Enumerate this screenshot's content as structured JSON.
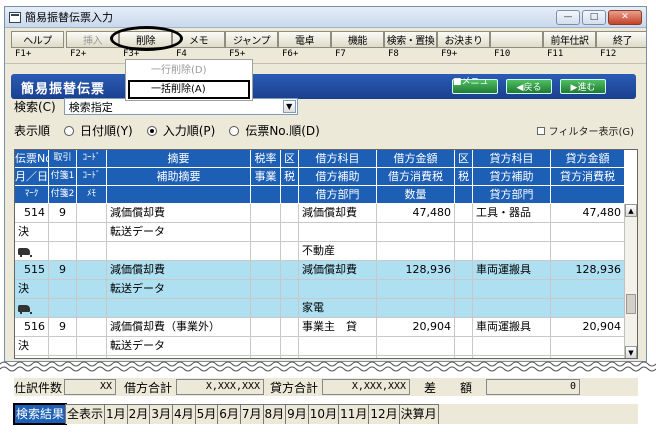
{
  "window": {
    "title": "簡易振替伝票入力",
    "min_glyph": "—",
    "max_glyph": "□",
    "close_glyph": "✕"
  },
  "toolbar": [
    {
      "label": "ヘルプ",
      "code": "F1+",
      "enabled": true
    },
    {
      "label": "挿入",
      "code": "F2+",
      "enabled": false
    },
    {
      "label": "削除",
      "code": "F3+",
      "enabled": true
    },
    {
      "label": "メモ",
      "code": "F4",
      "enabled": true
    },
    {
      "label": "ジャンプ",
      "code": "F5+",
      "enabled": true
    },
    {
      "label": "電卓",
      "code": "F6+",
      "enabled": true
    },
    {
      "label": "機能",
      "code": "F7",
      "enabled": true
    },
    {
      "label": "検索・置換",
      "code": "F8",
      "enabled": true
    },
    {
      "label": "お決まり",
      "code": "F9+",
      "enabled": true
    },
    {
      "label": "",
      "code": "F10",
      "enabled": true
    },
    {
      "label": "前年仕訳",
      "code": "F11",
      "enabled": true
    },
    {
      "label": "終了",
      "code": "F12",
      "enabled": true
    }
  ],
  "delete_menu": {
    "item1": "一行削除(D)",
    "item2": "一括削除(A)"
  },
  "header": {
    "title": "簡易振替伝票",
    "menu_btn": "■メニュー",
    "back_btn": "◀戻る",
    "next_btn": "▶進む"
  },
  "search": {
    "label": "検索(C)",
    "value": "検索指定",
    "arrow": "▼"
  },
  "sort": {
    "label": "表示順",
    "opt1": "日付順(Y)",
    "opt2": "入力順(P)",
    "opt3": "伝票No.順(D)",
    "filter": "フィルター表示(G)"
  },
  "columns": {
    "row1": [
      "伝票No.",
      "取引",
      "ｺｰﾄﾞ",
      "摘要",
      "税率",
      "区",
      "借方科目",
      "借方金額",
      "区",
      "貸方科目",
      "貸方金額"
    ],
    "row2": [
      "月／日",
      "付箋1",
      "ｺｰﾄﾞ",
      "補助摘要",
      "事業",
      "税",
      "借方補助",
      "借方消費税",
      "税",
      "貸方補助",
      "貸方消費税"
    ],
    "row3": [
      "ﾏｰｸ",
      "付箋2",
      "ﾒﾓ",
      "",
      "",
      "",
      "借方部門",
      "数量",
      "",
      "貸方部門",
      ""
    ]
  },
  "rows": [
    {
      "no": "514",
      "tx": "9",
      "tekiyo": "減価償却費",
      "debit_acct": "減価償却費",
      "debit_amt": "47,480",
      "credit_acct": "工具・器品",
      "credit_amt": "47,480",
      "mark": "決",
      "sub": "転送データ",
      "dept": "不動産"
    },
    {
      "no": "515",
      "tx": "9",
      "tekiyo": "減価償却費",
      "debit_acct": "減価償却費",
      "debit_amt": "128,936",
      "credit_acct": "車両運搬具",
      "credit_amt": "128,936",
      "mark": "決",
      "sub": "転送データ",
      "dept": "家電"
    },
    {
      "no": "516",
      "tx": "9",
      "tekiyo": "減価償却費（事業外）",
      "debit_acct": "事業主　貸",
      "debit_amt": "20,904",
      "credit_acct": "車両運搬具",
      "credit_amt": "20,904",
      "mark": "決",
      "sub": "転送データ",
      "dept": ""
    }
  ],
  "totals": {
    "count_label": "仕訳件数",
    "count": "XX",
    "debit_label": "借方合計",
    "debit": "X,XXX,XXX",
    "credit_label": "貸方合計",
    "credit": "X,XXX,XXX",
    "diff_label": "差　　額",
    "diff": "0"
  },
  "tabs": [
    "検索結果",
    "全表示",
    "1月",
    "2月",
    "3月",
    "4月",
    "5月",
    "6月",
    "7月",
    "8月",
    "9月",
    "10月",
    "11月",
    "12月",
    "決算月"
  ]
}
